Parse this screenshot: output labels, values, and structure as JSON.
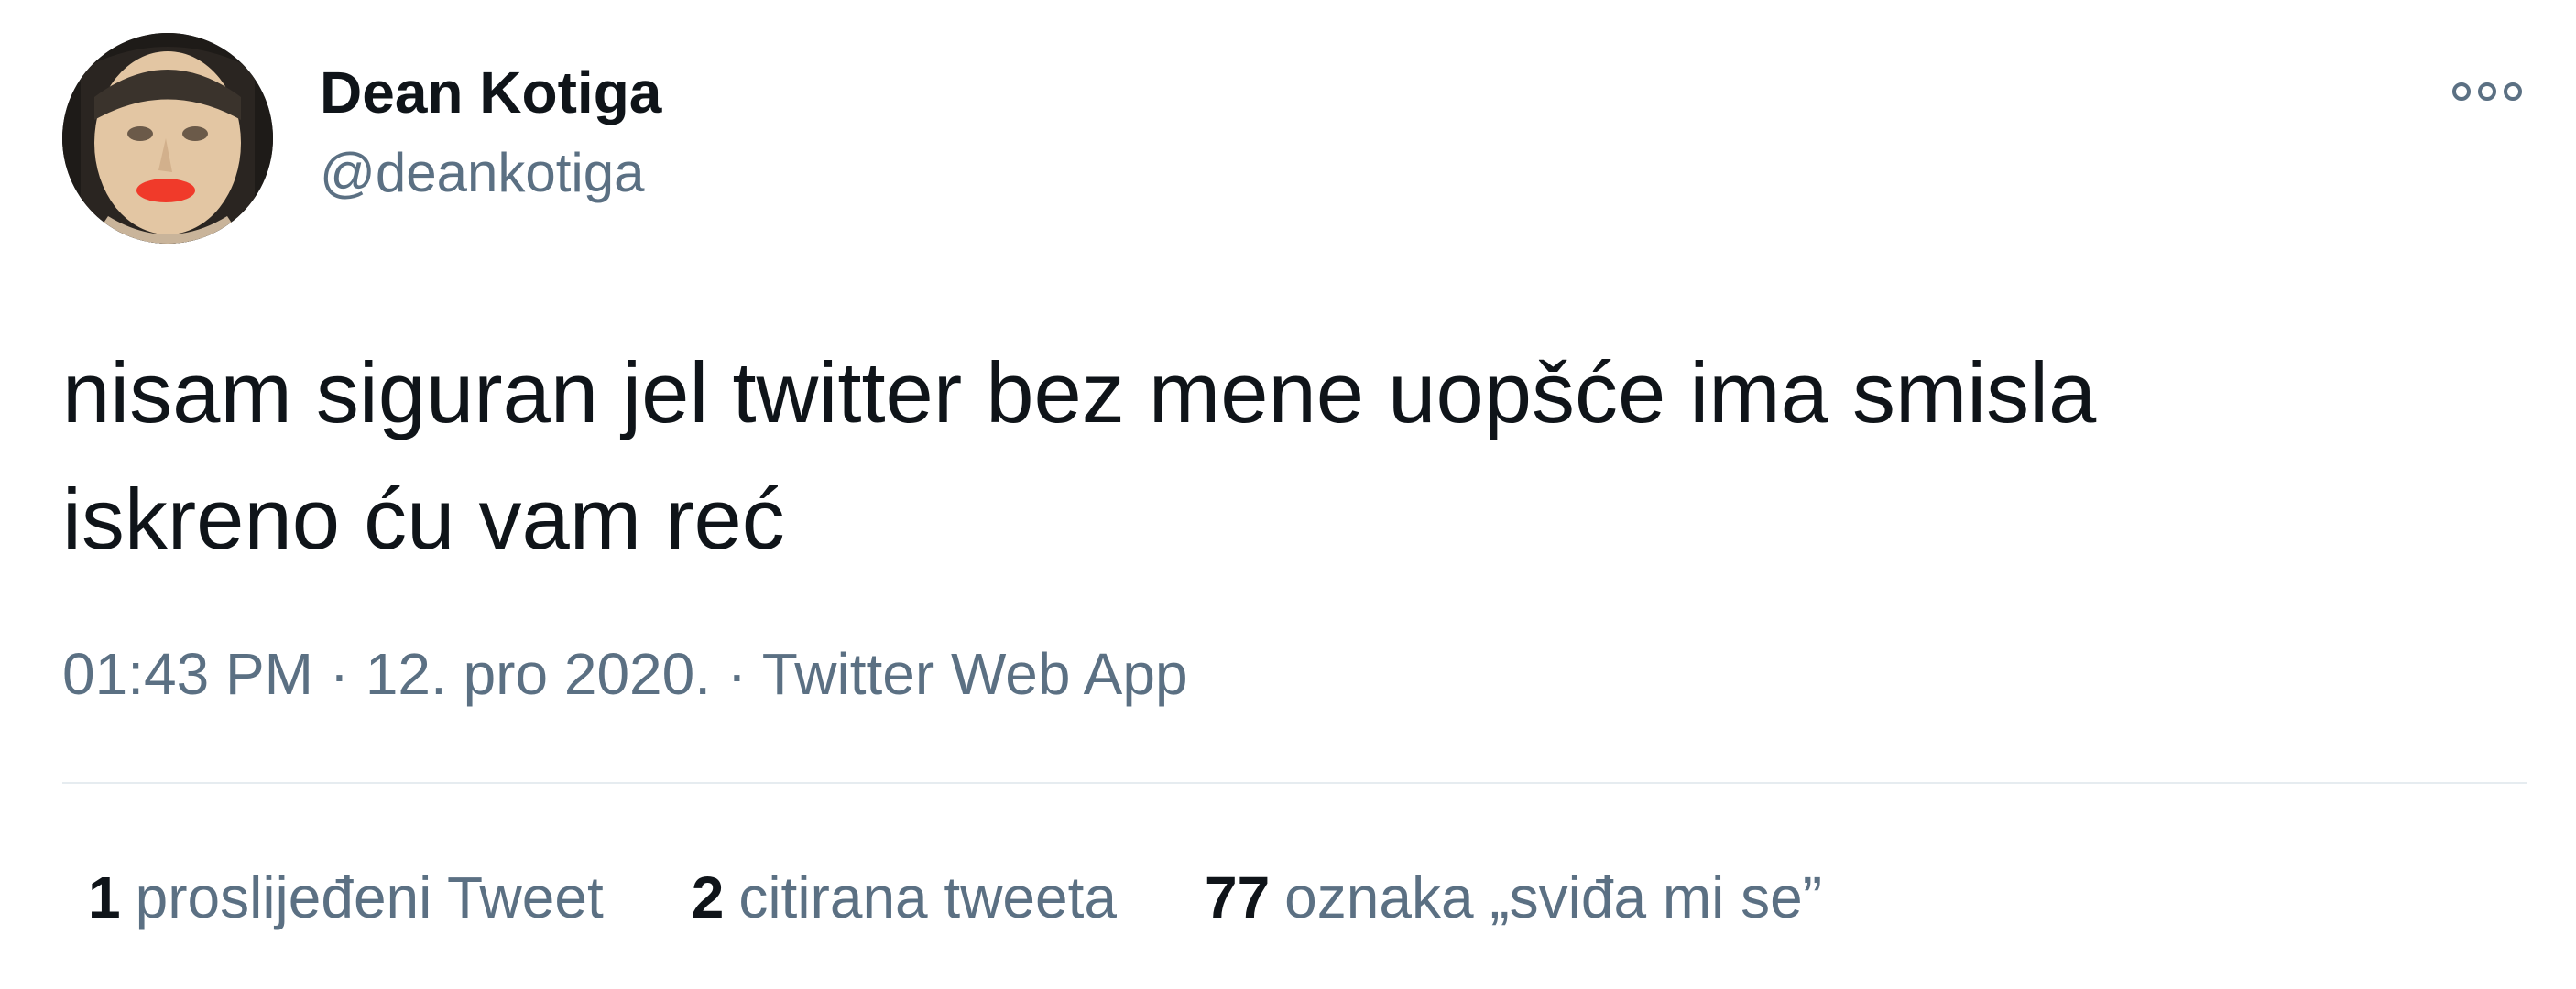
{
  "user": {
    "display_name": "Dean Kotiga",
    "handle": "@deankotiga",
    "avatar_icon": "profile-photo"
  },
  "more_icon": "more-options-icon",
  "tweet": {
    "lines": [
      "nisam siguran jel twitter bez mene uopšće ima smisla",
      "iskreno ću vam reć"
    ]
  },
  "meta": {
    "time": "01:43 PM",
    "separator": "·",
    "date": "12. pro 2020.",
    "source": "Twitter Web App"
  },
  "stats": [
    {
      "count": "1",
      "label": "proslijeđeni Tweet"
    },
    {
      "count": "2",
      "label": "citirana tweeta"
    },
    {
      "count": "77",
      "label": "oznaka „sviđa mi se”"
    }
  ],
  "colors": {
    "text_primary": "#0f1419",
    "text_secondary": "#5b7083",
    "divider": "#e6ecf0",
    "background": "#ffffff"
  }
}
